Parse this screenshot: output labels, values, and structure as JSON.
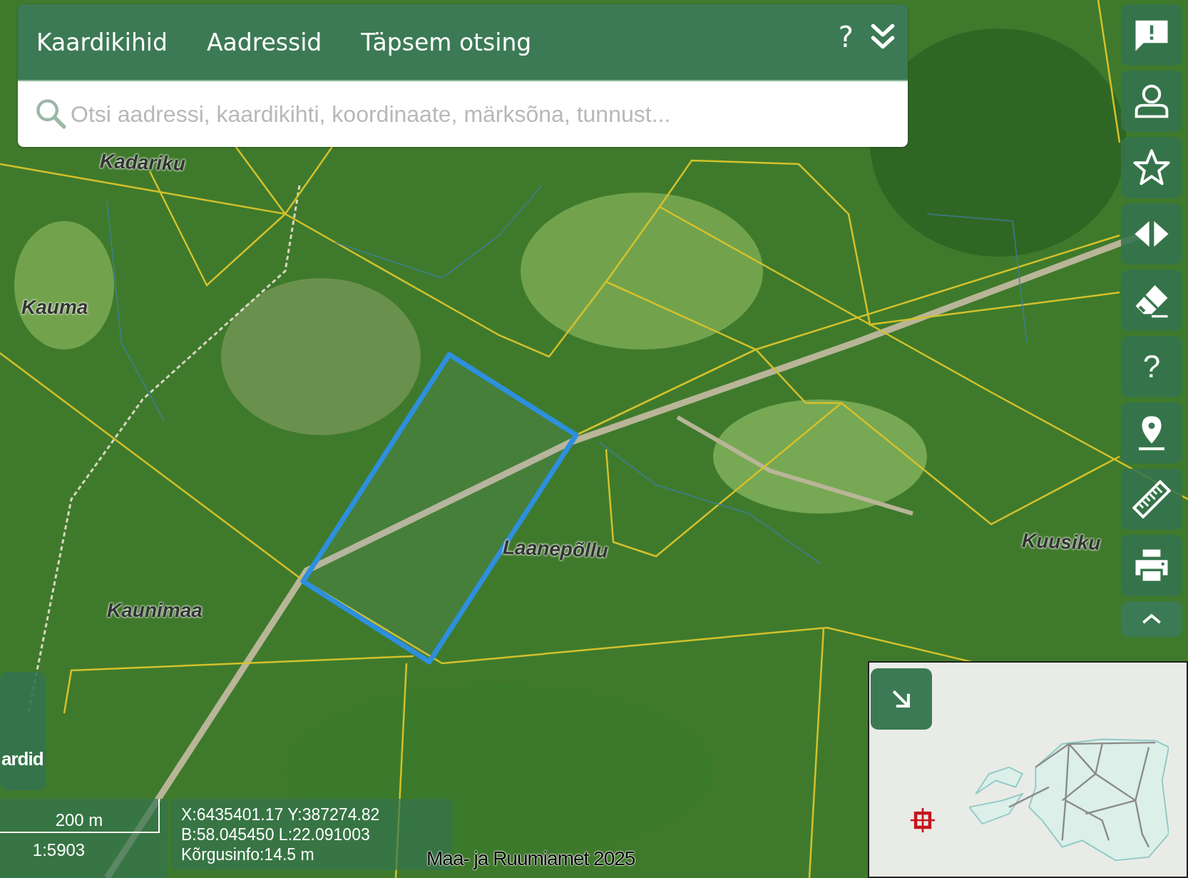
{
  "header": {
    "tabs": [
      {
        "label": "Kaardikihid"
      },
      {
        "label": "Aadressid"
      },
      {
        "label": "Täpsem otsing"
      }
    ],
    "help_label": "?"
  },
  "search": {
    "placeholder": "Otsi aadressi, kaardikihti, koordinaate, märksõna, tunnust..."
  },
  "toolbar": [
    {
      "kind": "feedback"
    },
    {
      "kind": "user"
    },
    {
      "kind": "favorite"
    },
    {
      "kind": "compare"
    },
    {
      "kind": "eraser"
    },
    {
      "kind": "help",
      "label": "?"
    },
    {
      "kind": "location"
    },
    {
      "kind": "measure"
    },
    {
      "kind": "print"
    },
    {
      "kind": "collapse"
    }
  ],
  "map_labels": [
    "Kadariku",
    "Kauma",
    "Laanepõllu",
    "Kaunimaa",
    "Kuusiku"
  ],
  "side_tab": {
    "label": "ardid"
  },
  "scale": {
    "distance": "200 m",
    "ratio": "1:5903"
  },
  "coordinates": [
    "X:6435401.17 Y:387274.82",
    "B:58.045450 L:22.091003",
    "Kõrgusinfo:14.5 m"
  ],
  "attribution": "Maa- ja Ruumiamet 2025"
}
